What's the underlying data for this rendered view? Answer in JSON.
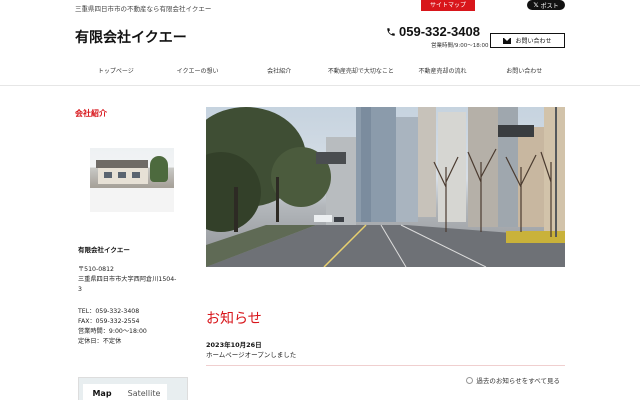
{
  "topbar": {
    "tagline": "三重県四日市市の不動産なら有限会社イクエー",
    "sitemap_label": "サイトマップ",
    "post_label": "ポスト"
  },
  "header": {
    "title": "有限会社イクエー",
    "phone": "059-332-3408",
    "hours": "営業時間/9:00〜18:00",
    "contact_label": "お問い合わせ"
  },
  "nav": {
    "items": [
      "トップページ",
      "イクエーの想い",
      "会社紹介",
      "不動産売却で大切なこと",
      "不動産売却の流れ",
      "お問い合わせ"
    ]
  },
  "sidebar": {
    "heading": "会社紹介",
    "company_name": "有限会社イクエー",
    "postal": "〒510-0812",
    "address_line1": "三重県四日市市大字西阿倉川1504-",
    "address_line2": "3",
    "tel": "TEL：059-332-3408",
    "fax": "FAX：059-332-2554",
    "hours": "営業時間：9:00〜18:00",
    "holiday": "定休日：不定休",
    "map_tab": "Map",
    "satellite_tab": "Satellite"
  },
  "news": {
    "heading": "お知らせ",
    "date": "2023年10月26日",
    "text": "ホームページオープンしました",
    "more": "過去のお知らせをすべて見る"
  },
  "colors": {
    "accent": "#d8161b",
    "dark": "#111111"
  }
}
